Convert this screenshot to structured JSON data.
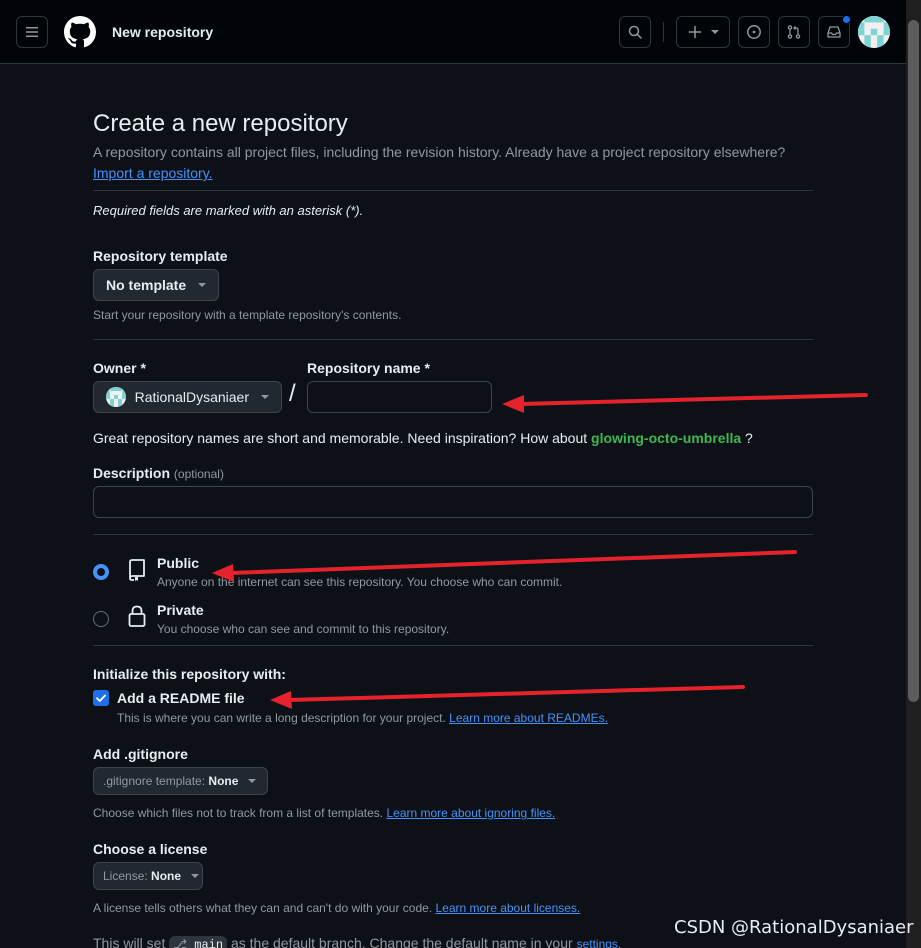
{
  "header": {
    "title": "New repository",
    "icons": [
      "menu-icon",
      "github-logo-icon",
      "search-icon",
      "plus-icon",
      "issues-icon",
      "pull-requests-icon",
      "inbox-icon"
    ]
  },
  "page": {
    "title": "Create a new repository",
    "subtitle": "A repository contains all project files, including the revision history. Already have a project repository elsewhere?",
    "import_link": "Import a repository.",
    "required_note": "Required fields are marked with an asterisk (*)."
  },
  "template": {
    "label": "Repository template",
    "value": "No template",
    "note": "Start your repository with a template repository's contents."
  },
  "owner": {
    "label": "Owner *",
    "value": "RationalDysaniaer"
  },
  "repo_name": {
    "label": "Repository name *",
    "value": "",
    "separator": "/"
  },
  "inspiration": {
    "text": "Great repository names are short and memorable. Need inspiration? How about",
    "suggestion": "glowing-octo-umbrella",
    "end": "?"
  },
  "description": {
    "label": "Description",
    "optional": "(optional)",
    "value": ""
  },
  "visibility": {
    "selected": "public",
    "public": {
      "title": "Public",
      "desc": "Anyone on the internet can see this repository. You choose who can commit."
    },
    "private": {
      "title": "Private",
      "desc": "You choose who can see and commit to this repository."
    }
  },
  "initialize": {
    "label": "Initialize this repository with:",
    "readme_label": "Add a README file",
    "readme_checked": true,
    "readme_note": "This is where you can write a long description for your project.",
    "readme_link": "Learn more about READMEs."
  },
  "gitignore": {
    "label": "Add .gitignore",
    "button_prefix": ".gitignore template:",
    "button_value": "None",
    "note": "Choose which files not to track from a list of templates.",
    "link": "Learn more about ignoring files."
  },
  "license": {
    "label": "Choose a license",
    "button_prefix": "License:",
    "button_value": "None",
    "note": "A license tells others what they can and can't do with your code.",
    "link": "Learn more about licenses."
  },
  "branch": {
    "prefix": "This will set",
    "name": "main",
    "suffix": "as the default branch. Change the default name in your",
    "link": "settings."
  },
  "watermark": "CSDN @RationalDysaniaer",
  "colors": {
    "accent": "#4493f8",
    "suggestion": "#3fb950",
    "arrow": "#e5222b"
  }
}
